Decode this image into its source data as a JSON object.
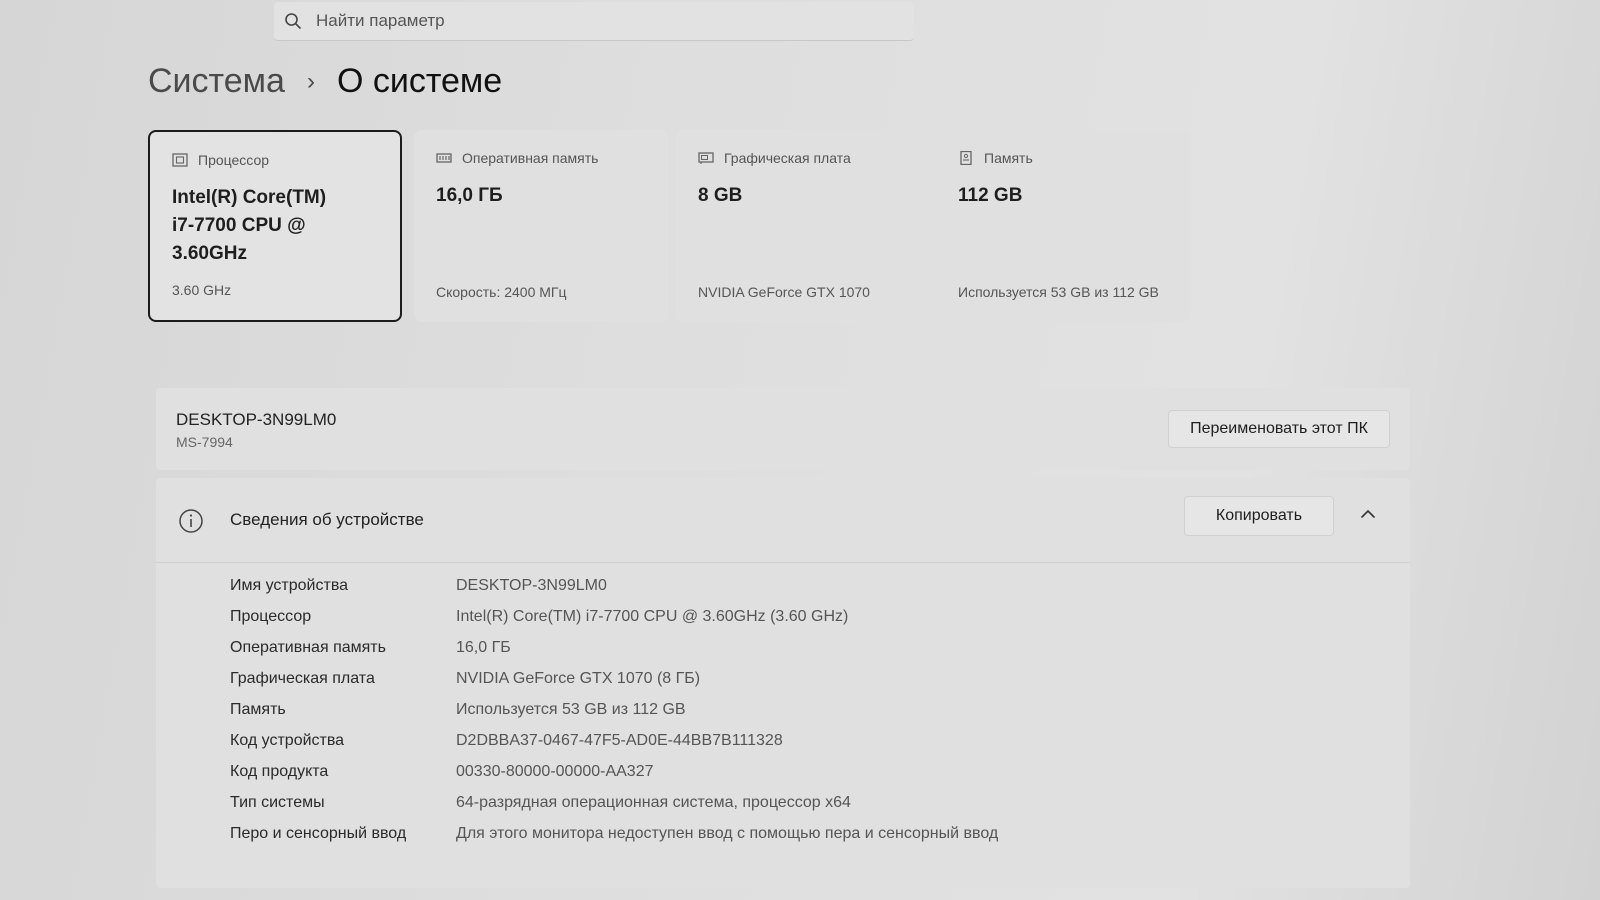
{
  "search": {
    "placeholder": "Найти параметр"
  },
  "breadcrumb": {
    "parent": "Система",
    "separator": "›",
    "current": "О системе"
  },
  "cards": [
    {
      "icon": "processor-icon",
      "title": "Процессор",
      "value": "Intel(R) Core(TM) i7-7700 CPU @ 3.60GHz",
      "sub": "3.60 GHz",
      "selected": true
    },
    {
      "icon": "ram-icon",
      "title": "Оперативная память",
      "value": "16,0 ГБ",
      "sub": "Скорость: 2400 МГц"
    },
    {
      "icon": "gpu-icon",
      "title": "Графическая плата",
      "value": "8 GB",
      "sub": "NVIDIA GeForce GTX 1070"
    },
    {
      "icon": "storage-icon",
      "title": "Память",
      "value": "112 GB",
      "sub": "Используется 53 GB из 112 GB"
    }
  ],
  "device": {
    "name": "DESKTOP-3N99LM0",
    "model": "MS-7994",
    "rename_label": "Переименовать этот ПК"
  },
  "device_info": {
    "title": "Сведения об устройстве",
    "copy_label": "Копировать",
    "rows": [
      {
        "label": "Имя устройства",
        "value": "DESKTOP-3N99LM0"
      },
      {
        "label": "Процессор",
        "value": "Intel(R) Core(TM) i7-7700 CPU @ 3.60GHz (3.60 GHz)"
      },
      {
        "label": "Оперативная память",
        "value": "16,0 ГБ"
      },
      {
        "label": "Графическая плата",
        "value": "NVIDIA GeForce GTX 1070 (8 ГБ)"
      },
      {
        "label": "Память",
        "value": "Используется 53 GB из 112 GB"
      },
      {
        "label": "Код устройства",
        "value": "D2DBBA37-0467-47F5-AD0E-44BB7B111328"
      },
      {
        "label": "Код продукта",
        "value": "00330-80000-00000-AA327"
      },
      {
        "label": "Тип системы",
        "value": "64-разрядная операционная система, процессор x64"
      },
      {
        "label": "Перо и сенсорный ввод",
        "value": "Для этого монитора недоступен ввод с помощью пера и сенсорный ввод"
      }
    ]
  }
}
